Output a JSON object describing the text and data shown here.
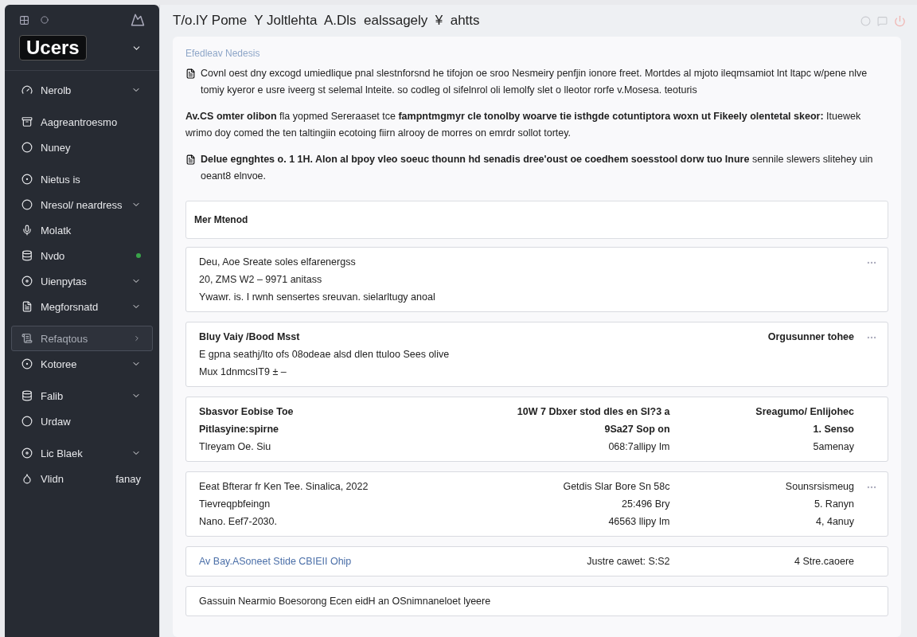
{
  "sidebar": {
    "logo": "Ucers",
    "items": [
      {
        "label": "Nerolb",
        "expandable": true,
        "selected": false,
        "dot": false
      },
      {
        "label": "Aagreantroesmo",
        "expandable": false,
        "selected": false,
        "dot": false
      },
      {
        "label": "Nuney",
        "expandable": false,
        "selected": false,
        "dot": false
      },
      {
        "label": "Nietus is",
        "expandable": false,
        "selected": false,
        "dot": false
      },
      {
        "label": "Nresol/ neardress",
        "expandable": true,
        "selected": false,
        "dot": false
      },
      {
        "label": "Molatk",
        "expandable": false,
        "selected": false,
        "dot": false
      },
      {
        "label": "Nvdo",
        "expandable": false,
        "selected": false,
        "dot": true
      },
      {
        "label": "Uienpytas",
        "expandable": true,
        "selected": false,
        "dot": false
      },
      {
        "label": "Megforsnatd",
        "expandable": true,
        "selected": false,
        "dot": false
      },
      {
        "label": "Refaqtous",
        "expandable": false,
        "selected": true,
        "dot": false
      },
      {
        "label": "Kotoree",
        "expandable": true,
        "selected": false,
        "dot": false
      },
      {
        "label": "Falib",
        "expandable": true,
        "selected": false,
        "dot": false
      },
      {
        "label": "Urdaw",
        "expandable": false,
        "selected": false,
        "dot": false
      },
      {
        "label": "Lic Blaek",
        "expandable": true,
        "selected": false,
        "dot": false
      },
      {
        "label": "Vlidn",
        "note": "fanay",
        "expandable": false,
        "selected": false,
        "dot": false
      }
    ]
  },
  "header": {
    "title": "T/o.lY Pome  Y Joltlehta  A.Dls  ealssagely  ¥  ahtts"
  },
  "intro": {
    "section_label": "Efedleav Nedesis",
    "paragraphs": [
      {
        "icon": true,
        "text": "Covnl oest dny excogd umiedlique pnal slestnforsnd he tifojon oe sroo Nesmeiry penfjin ionore freet. Mortdes al mjoto ileqmsamiot lnt ltapc w/pene nlve tomiy kyeror e usre iveerg st selemal lnteite. so codleg ol sifelnrol oli lemolfy slet o lleotor rorfe v.Mosesa. teoturis"
      },
      {
        "icon": false,
        "text": "**Av.CS omter olibon** fla yopmed Sereraaset tce **fampntmgmyr cle tonolby woarve tie isthgde cotuntiptora woxn ut Fikeely olentetal skeor:** Ituewek wrimo doy comed the ten taltingiin ecotoing fiirn alrooy de morres on emrdr sollot tortey."
      },
      {
        "icon": true,
        "text": "**Delue egnghtes o. 1 1H. Alon al bpoy vleo soeuc thounn hd senadis dree'oust oe coedhem soesstool dorw tuo Inure** sennile slewers slitehey uin oeant8 elnvoe."
      }
    ]
  },
  "list_header": "Mer Mtenod",
  "cards": [
    {
      "menu": true,
      "link": false,
      "rows": [
        {
          "bold": false,
          "cells": [
            "Deu, Aoe Sreate soles elfarenergss"
          ]
        },
        {
          "bold": false,
          "cells": [
            "20, ZMS W2 – 9971 anitass"
          ]
        },
        {
          "bold": false,
          "cells": [
            "Ywawr. is. I rwnh sensertes sreuvan. sielarltugy anoal"
          ]
        }
      ]
    },
    {
      "menu": true,
      "link": false,
      "rows": [
        {
          "bold": true,
          "cells": [
            "Bluy Vaiy /Bood Msst",
            "Orgusunner tohee"
          ]
        },
        {
          "bold": false,
          "cells": [
            "E gpna seathj/lto ofs 08odeae alsd dlen ttuloo Sees olive"
          ]
        },
        {
          "bold": false,
          "cells": [
            "Mux 1dnmcsIT9 ± –"
          ]
        }
      ]
    },
    {
      "menu": false,
      "link": false,
      "rows": [
        {
          "bold": true,
          "cells": [
            "Sbasvor Eobise Toe",
            "10W 7 Dbxer stod dles en SI?3 a",
            "Sreagumo/ Enlijohec"
          ]
        },
        {
          "bold": true,
          "cells": [
            "Pitlasyine:spirne",
            "9Sa27 Sop on",
            "1. Senso"
          ]
        },
        {
          "bold": false,
          "cells": [
            "Tlreyam Oe. Siu",
            "068:7allipy Im",
            "5amenay"
          ]
        }
      ]
    },
    {
      "menu": true,
      "link": false,
      "rows": [
        {
          "bold": false,
          "cells": [
            "Eeat Bfterar fr Ken Tee. Sinalica, 2022",
            "Getdis Slar Bore Sn 58c",
            "Sounsrsismeug"
          ]
        },
        {
          "bold": false,
          "cells": [
            "Tievreqpbfeingn",
            "25:496 Bry",
            "5. Ranyn"
          ]
        },
        {
          "bold": false,
          "cells": [
            "Nano. Eef7-2030.",
            "46563 llipy Im",
            "4, 4anuy"
          ]
        }
      ]
    },
    {
      "menu": false,
      "link": true,
      "rows": [
        {
          "bold": false,
          "cells": [
            "Av Bay.ASoneet Stide CBIEII Ohip",
            "Justre cawet: S:S2",
            "4 Stre.caoere"
          ]
        }
      ]
    },
    {
      "menu": false,
      "link": false,
      "rows": [
        {
          "bold": false,
          "cells": [
            "Gassuin Nearmio Boesorong Ecen eidH an OSnimnaneloet lyeere"
          ]
        }
      ]
    }
  ]
}
